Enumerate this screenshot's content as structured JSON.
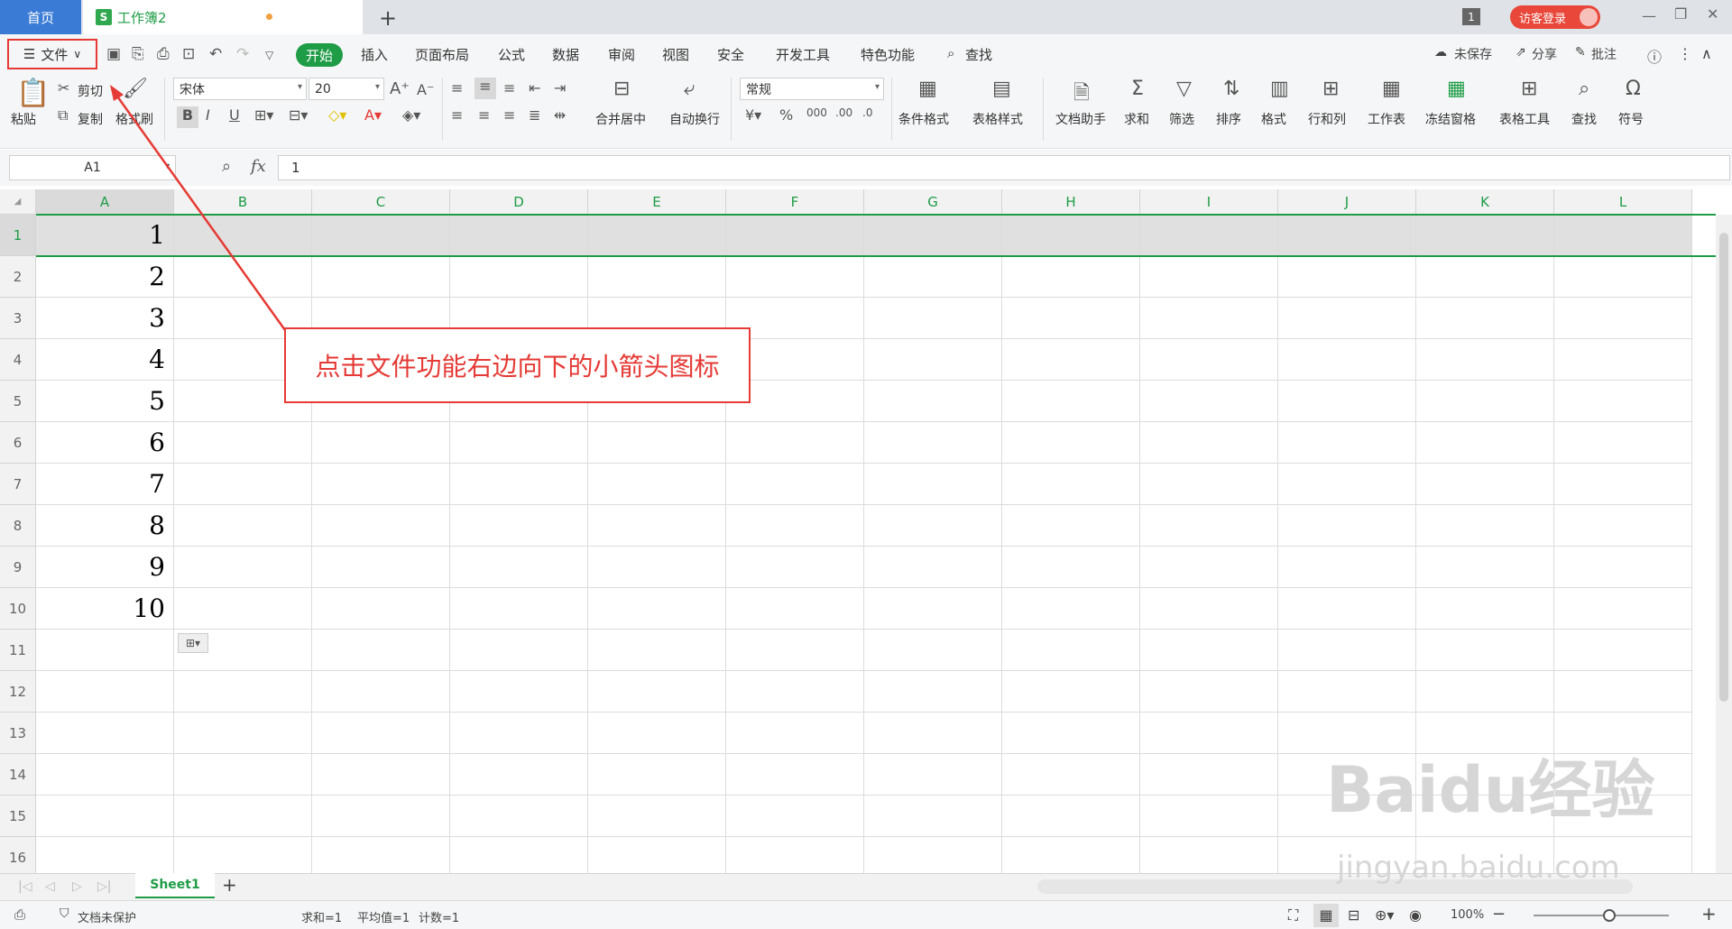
{
  "tabs": {
    "home": "首页",
    "workbook": "工作簿2",
    "workbook_icon": "S",
    "window_count": "1",
    "login": "访客登录"
  },
  "menu": {
    "file": "文件",
    "items": [
      "开始",
      "插入",
      "页面布局",
      "公式",
      "数据",
      "审阅",
      "视图",
      "安全",
      "开发工具",
      "特色功能",
      "查找"
    ],
    "right": [
      "未保存",
      "分享",
      "批注"
    ]
  },
  "ribbon": {
    "paste": "粘贴",
    "cut": "剪切",
    "copy": "复制",
    "format_painter": "格式刷",
    "font_name": "宋体",
    "font_size": "20",
    "merge": "合并居中",
    "wrap": "自动换行",
    "number_format": "常规",
    "tools": [
      "条件格式",
      "表格样式",
      "文档助手",
      "求和",
      "筛选",
      "排序",
      "格式",
      "行和列",
      "工作表",
      "冻结窗格",
      "表格工具",
      "查找",
      "符号"
    ]
  },
  "formula": {
    "cell_ref": "A1",
    "fx": "fx",
    "value": "1"
  },
  "columns": [
    "A",
    "B",
    "C",
    "D",
    "E",
    "F",
    "G",
    "H",
    "I",
    "J",
    "K",
    "L"
  ],
  "rows": [
    "1",
    "2",
    "3",
    "4",
    "5",
    "6",
    "7",
    "8",
    "9",
    "10",
    "11",
    "12",
    "13",
    "14",
    "15",
    "16"
  ],
  "cells_A": [
    "1",
    "2",
    "3",
    "4",
    "5",
    "6",
    "7",
    "8",
    "9",
    "10"
  ],
  "sheet": {
    "name": "Sheet1"
  },
  "status": {
    "protect": "文档未保护",
    "sum": "求和=1",
    "avg": "平均值=1",
    "count": "计数=1",
    "zoom": "100%"
  },
  "annotation": "点击文件功能右边向下的小箭头图标",
  "watermark": {
    "brand": "Baidu经验",
    "url": "jingyan.baidu.com"
  },
  "colors": {
    "accent_green": "#1e9c46",
    "annotation_red": "#e53a35",
    "home_tab_blue": "#3a7bd5"
  }
}
